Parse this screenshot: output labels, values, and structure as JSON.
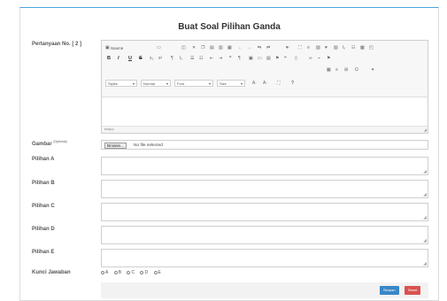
{
  "page": {
    "title": "Buat Soal Pilihan Ganda"
  },
  "question": {
    "label": "Pertanyaan No. [ 2 ]"
  },
  "editor": {
    "source_label": "Source",
    "styles_label": "Styles",
    "format_label": "Normal",
    "font_label": "Font",
    "size_label": "Size",
    "status_path": "body p",
    "toolbar_row2": [
      "B",
      "I",
      "U",
      "S",
      "x₂",
      "x²",
      "¶",
      "Iₓ"
    ]
  },
  "image": {
    "label": "Gambar",
    "optional": "(Optional)",
    "browse_label": "Browse...",
    "file_status": "No file selected"
  },
  "options": [
    {
      "label": "Pilihan A"
    },
    {
      "label": "Pilihan B"
    },
    {
      "label": "Pilihan C"
    },
    {
      "label": "Pilihan D"
    },
    {
      "label": "Pilihan E"
    }
  ],
  "answer": {
    "label": "Kunci Jawaban",
    "choices": [
      "A",
      "B",
      "C",
      "D",
      "E"
    ]
  },
  "actions": {
    "save_label": "Simpan",
    "reset_label": "Reset"
  },
  "colors": {
    "save": "#3a87c8",
    "reset": "#d9534f",
    "accent_border": "#4aa3df"
  }
}
